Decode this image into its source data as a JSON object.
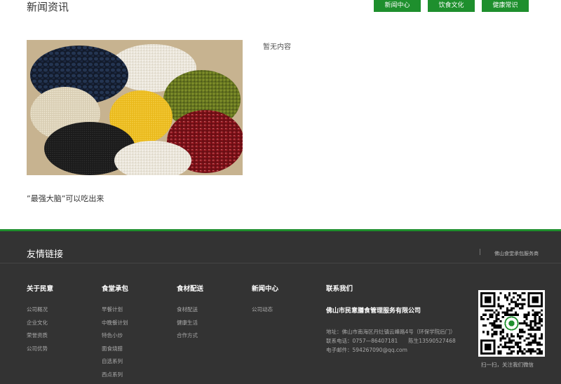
{
  "header": {
    "title": "新闻资讯",
    "tabs": [
      "新闻中心",
      "饮食文化",
      "健康常识"
    ]
  },
  "news": {
    "empty_text": "暂无内容",
    "caption": "”最强大脑”可以吃出来",
    "image_alt": "grains-photo"
  },
  "footer": {
    "friend_links_title": "友情链接",
    "friend_separator": "|",
    "friend_links": [
      "佛山食堂承包服务商"
    ],
    "columns": [
      {
        "title": "关于民意",
        "items": [
          "公司概况",
          "企业文化",
          "荣誉资质",
          "公司优势"
        ]
      },
      {
        "title": "食堂承包",
        "items": [
          "早餐计划",
          "中晚餐计划",
          "特色小炒",
          "面食烧腊",
          "自选系列",
          "西点系列"
        ]
      },
      {
        "title": "食材配送",
        "items": [
          "食材配送",
          "健康生活",
          "合作方式"
        ]
      },
      {
        "title": "新闻中心",
        "items": [
          "公司动态"
        ]
      }
    ],
    "contact": {
      "title": "联系我们",
      "company": "佛山市民意膳食管理服务有限公司",
      "address": "地址：佛山市南海区丹灶镇云峰路4号（环保学院后门）",
      "phone": "联系电话：0757—86407181　　陈生13590527468",
      "email": "电子邮件：594267090@qq.com"
    },
    "qr_caption": "扫一扫，关注我们微信"
  },
  "colors": {
    "accent": "#1e8f2d",
    "footer_bg": "#333333"
  }
}
